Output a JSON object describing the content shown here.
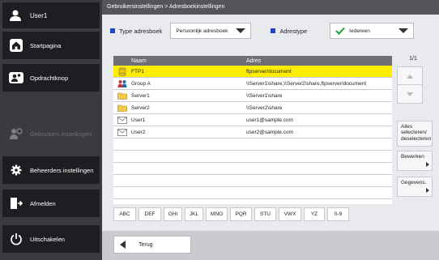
{
  "sidebar": {
    "user_name": "User1",
    "items": [
      {
        "label": "Startpagina",
        "icon": "home-icon"
      },
      {
        "label": "Opdrachtknop",
        "icon": "users-icon"
      },
      {
        "label": "Gebruikers instellingen",
        "icon": "user-settings-icon",
        "disabled": true
      },
      {
        "label": "Beheerders instellingen",
        "icon": "gear-icon"
      },
      {
        "label": "Afmelden",
        "icon": "logout-icon"
      },
      {
        "label": "Uitschakelen",
        "icon": "power-icon"
      }
    ]
  },
  "breadcrumb": "Gebruikersinstellingen > Adresboekinstellingen",
  "filters": {
    "type_label": "Type adresboek",
    "type_value": "Persoonlijk adresboek",
    "addr_label": "Adrestype",
    "addr_value": "Iedereen"
  },
  "table": {
    "col_name": "Naam",
    "col_address": "Adres",
    "rows": [
      {
        "name": "FTP1",
        "address": "ftpserver/document",
        "icon": "ftp-server-icon",
        "selected": true
      },
      {
        "name": "Group A",
        "address": "\\\\Server1\\share,\\\\Server2\\share,ftpserver/document",
        "icon": "group-icon",
        "selected": false
      },
      {
        "name": "Server1",
        "address": "\\\\Server1\\share",
        "icon": "folder-icon",
        "selected": false
      },
      {
        "name": "Server2",
        "address": "\\\\Server2\\share",
        "icon": "folder-icon",
        "selected": false
      },
      {
        "name": "User1",
        "address": "user1@sample.com",
        "icon": "email-icon",
        "selected": false
      },
      {
        "name": "User2",
        "address": "user2@sample.com",
        "icon": "email-icon",
        "selected": false
      }
    ]
  },
  "page_indicator": "1/1",
  "actions": {
    "select_all": "Alles selecteren/ deselecteren",
    "edit": "Bewerken",
    "details": "Gegevens."
  },
  "alpha_index": [
    "ABC",
    "DEF",
    "GHI",
    "JKL",
    "MNO",
    "PQR",
    "STU",
    "VWX",
    "YZ",
    "0-9"
  ],
  "back_label": "Terug",
  "colors": {
    "accent": "#1a46c8",
    "selection": "#ffed00",
    "sidebar": "#1e1e22"
  }
}
